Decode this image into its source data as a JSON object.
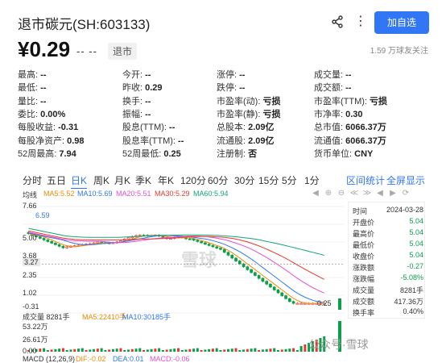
{
  "header": {
    "title": "退市碳元(SH:603133)",
    "share_icon": "share-icon",
    "more_icon": "more-dots-icon",
    "add_button": "加自选"
  },
  "quote": {
    "price": "¥0.29",
    "change": "-- --",
    "status": "退市",
    "followers": "1.59 万球友关注"
  },
  "stats": {
    "col1": [
      {
        "k": "最高:",
        "v": "--"
      },
      {
        "k": "最低:",
        "v": "--"
      },
      {
        "k": "量比:",
        "v": "--"
      },
      {
        "k": "委比:",
        "v": "0.00%"
      },
      {
        "k": "每股收益:",
        "v": "-0.31"
      },
      {
        "k": "每股净资产:",
        "v": "0.98"
      },
      {
        "k": "52周最高:",
        "v": "7.94"
      }
    ],
    "col2": [
      {
        "k": "今开:",
        "v": "--"
      },
      {
        "k": "昨收:",
        "v": "0.29"
      },
      {
        "k": "换手:",
        "v": "--"
      },
      {
        "k": "振幅:",
        "v": "--"
      },
      {
        "k": "股息(TTM):",
        "v": "--"
      },
      {
        "k": "股息率(TTM):",
        "v": "--"
      },
      {
        "k": "52周最低:",
        "v": "0.25"
      }
    ],
    "col3": [
      {
        "k": "涨停:",
        "v": "--"
      },
      {
        "k": "跌停:",
        "v": "--"
      },
      {
        "k": "市盈率(动):",
        "v": "亏损"
      },
      {
        "k": "市盈率(静):",
        "v": "亏损"
      },
      {
        "k": "总股本:",
        "v": "2.09亿"
      },
      {
        "k": "流通股:",
        "v": "2.09亿"
      },
      {
        "k": "注册制:",
        "v": "否"
      }
    ],
    "col4": [
      {
        "k": "成交量:",
        "v": "--"
      },
      {
        "k": "成交额:",
        "v": "--"
      },
      {
        "k": "市盈率(TTM):",
        "v": "亏损"
      },
      {
        "k": "市净率:",
        "v": "0.30"
      },
      {
        "k": "总市值:",
        "v": "6066.37万"
      },
      {
        "k": "流通值:",
        "v": "6066.37万"
      },
      {
        "k": "货币单位:",
        "v": "CNY"
      }
    ]
  },
  "tabs": [
    "分时",
    "五日",
    "日K",
    "周K",
    "月K",
    "季K",
    "年K",
    "120分",
    "60分",
    "30分",
    "15分",
    "5分",
    "1分"
  ],
  "active_tab": "日K",
  "links": {
    "interval_stats": "区间统计",
    "fullscreen": "全屏显示"
  },
  "ma": {
    "label": "均线",
    "ma5": "MA5:5.52",
    "ma10": "MA10:5.69",
    "ma20": "MA20:5.51",
    "ma30": "MA30:5.29",
    "ma60": "MA60:5.94"
  },
  "colors": {
    "up": "#e8392d",
    "down": "#0b9e4b",
    "ma5": "#f08a00",
    "ma10": "#3177f5",
    "ma20": "#e54fd4",
    "ma30": "#e8392d",
    "ma60": "#11a57a",
    "accent": "#3177f5"
  },
  "y_axis": [
    "7.66",
    "6.59",
    "5.00",
    "3.68",
    "3.27",
    "2.35",
    "1.02",
    "-0.31"
  ],
  "low_marker": "0.25",
  "tooltip": [
    {
      "k": "时间",
      "v": "2024-03-28"
    },
    {
      "k": "开盘价",
      "v": "5.04"
    },
    {
      "k": "最高价",
      "v": "5.04"
    },
    {
      "k": "最低价",
      "v": "5.04"
    },
    {
      "k": "收盘价",
      "v": "5.04"
    },
    {
      "k": "涨跌额",
      "v": "-0.27"
    },
    {
      "k": "涨跌幅",
      "v": "-5.08%"
    },
    {
      "k": "成交量",
      "v": "8281手"
    },
    {
      "k": "成交额",
      "v": "417.36万"
    },
    {
      "k": "换手率",
      "v": "0.40%"
    }
  ],
  "volume": {
    "label": "成交量 8281手",
    "ma5": "MA5:22410手",
    "ma10": "MA10:30185手",
    "y_axis": [
      "53.22万",
      "26.61万",
      "0.00"
    ]
  },
  "macd": {
    "label": "MACD (12,26,9)",
    "dif": "DIF:-0.02",
    "dea": "DEA:0.01",
    "macd": "MACD:-0.06"
  },
  "watermark": "雪球",
  "wechat_watermark": "公众号·雪球"
}
